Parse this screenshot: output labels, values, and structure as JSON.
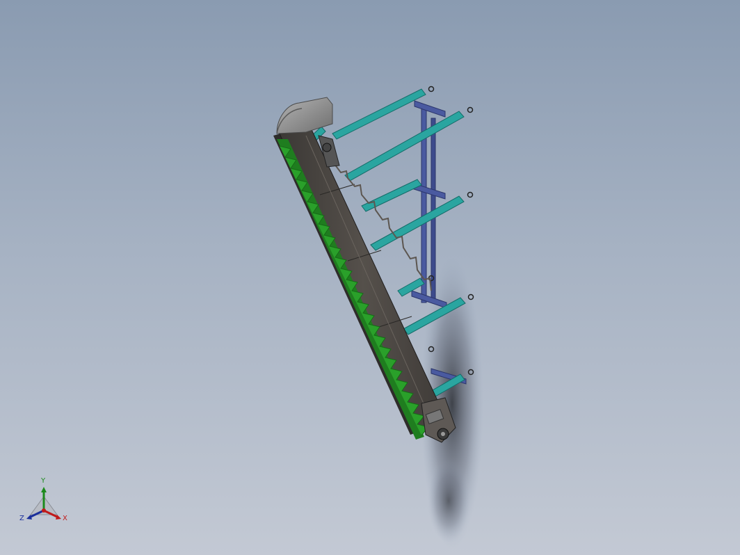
{
  "viewport": {
    "background_top": "#8a9bb1",
    "background_bottom": "#c3c9d4"
  },
  "model": {
    "description_icon": "conveyor-assembly-icon",
    "colors": {
      "frame_dark": "#4a4642",
      "frame_side": "#3a3735",
      "belt_green": "#2aa02a",
      "crossbar_teal": "#2aa5a0",
      "support_blue": "#4a5aa0",
      "hood_gray": "#8c8c8c"
    }
  },
  "triad": {
    "icon": "orientation-triad-icon",
    "y_label": "Y",
    "x_label": "X",
    "z_label": "Z",
    "colors": {
      "x": "#c01a1a",
      "y": "#1c8a1c",
      "z": "#1b2f9b"
    }
  }
}
